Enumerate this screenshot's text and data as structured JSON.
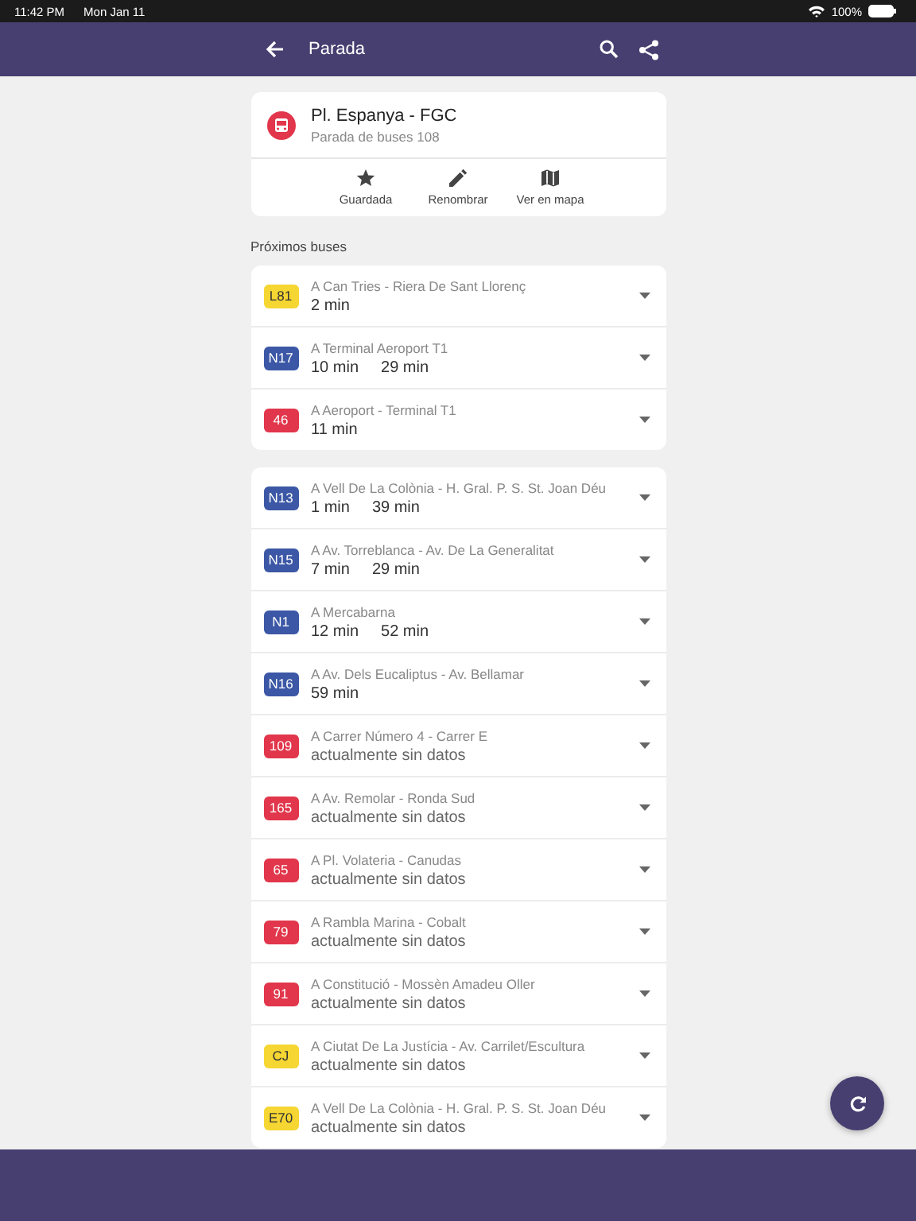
{
  "status_bar": {
    "time": "11:42 PM",
    "date": "Mon Jan 11",
    "battery": "100%"
  },
  "header": {
    "title": "Parada"
  },
  "stop": {
    "name": "Pl. Espanya - FGC",
    "subtitle": "Parada de buses 108",
    "actions": [
      {
        "kind": "star",
        "label": "Guardada"
      },
      {
        "kind": "edit",
        "label": "Renombrar"
      },
      {
        "kind": "map",
        "label": "Ver en mapa"
      }
    ]
  },
  "section_title": "Próximos buses",
  "groups": [
    {
      "rows": [
        {
          "line": "L81",
          "color": "#f5d632",
          "destination": "A Can Tries - Riera De Sant Llorenç",
          "kind": "times",
          "times": [
            "2 min"
          ]
        },
        {
          "line": "N17",
          "color": "#3b57a5",
          "destination": "A Terminal Aeroport T1",
          "kind": "times",
          "times": [
            "10 min",
            "29 min"
          ]
        },
        {
          "line": "46",
          "color": "#e1364b",
          "destination": "A Aeroport - Terminal T1",
          "kind": "times",
          "times": [
            "11 min"
          ]
        }
      ]
    },
    {
      "rows": [
        {
          "line": "N13",
          "color": "#3b57a5",
          "destination": "A Vell De La Colònia - H. Gral. P. S. St. Joan Déu",
          "kind": "times",
          "times": [
            "1 min",
            "39 min"
          ]
        },
        {
          "line": "N15",
          "color": "#3b57a5",
          "destination": "A Av. Torreblanca - Av. De La Generalitat",
          "kind": "times",
          "times": [
            "7 min",
            "29 min"
          ]
        },
        {
          "line": "N1",
          "color": "#3b57a5",
          "destination": "A Mercabarna",
          "kind": "times",
          "times": [
            "12 min",
            "52 min"
          ]
        },
        {
          "line": "N16",
          "color": "#3b57a5",
          "destination": "A Av. Dels Eucaliptus - Av. Bellamar",
          "kind": "times",
          "times": [
            "59 min"
          ]
        },
        {
          "line": "109",
          "color": "#e1364b",
          "destination": "A Carrer Número 4 - Carrer E",
          "kind": "no_data",
          "times": [
            "actualmente sin datos"
          ]
        },
        {
          "line": "165",
          "color": "#e1364b",
          "destination": "A Av. Remolar - Ronda Sud",
          "kind": "no_data",
          "times": [
            "actualmente sin datos"
          ]
        },
        {
          "line": "65",
          "color": "#e1364b",
          "destination": "A Pl. Volateria - Canudas",
          "kind": "no_data",
          "times": [
            "actualmente sin datos"
          ]
        },
        {
          "line": "79",
          "color": "#e1364b",
          "destination": "A Rambla Marina - Cobalt",
          "kind": "no_data",
          "times": [
            "actualmente sin datos"
          ]
        },
        {
          "line": "91",
          "color": "#e1364b",
          "destination": "A Constitució - Mossèn Amadeu Oller",
          "kind": "no_data",
          "times": [
            "actualmente sin datos"
          ]
        },
        {
          "line": "CJ",
          "color": "#f5d632",
          "destination": "A Ciutat De La Justícia - Av. Carrilet/Escultura",
          "kind": "no_data",
          "times": [
            "actualmente sin datos"
          ]
        },
        {
          "line": "E70",
          "color": "#f5d632",
          "destination": "A Vell De La Colònia - H. Gral. P. S. St. Joan Déu",
          "kind": "no_data",
          "times": [
            "actualmente sin datos"
          ]
        }
      ]
    }
  ]
}
